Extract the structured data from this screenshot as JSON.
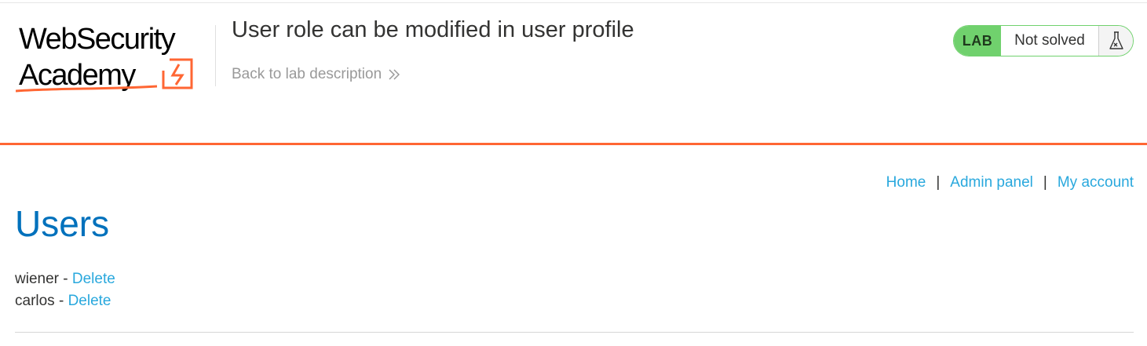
{
  "header": {
    "logo_line1": "WebSecurity",
    "logo_line2": "Academy",
    "lab_title": "User role can be modified in user profile",
    "back_link": "Back to lab description"
  },
  "status": {
    "badge": "LAB",
    "state": "Not solved",
    "icon": "flask-icon"
  },
  "nav": {
    "items": [
      {
        "label": "Home"
      },
      {
        "label": "Admin panel"
      },
      {
        "label": "My account"
      }
    ],
    "separator": "|"
  },
  "main": {
    "heading": "Users",
    "users": [
      {
        "name": "wiener",
        "action": "Delete"
      },
      {
        "name": "carlos",
        "action": "Delete"
      }
    ]
  },
  "colors": {
    "accent_orange": "#ff6633",
    "link_blue": "#29a8dd",
    "heading_blue": "#0071bc",
    "lab_green": "#70d16d"
  }
}
